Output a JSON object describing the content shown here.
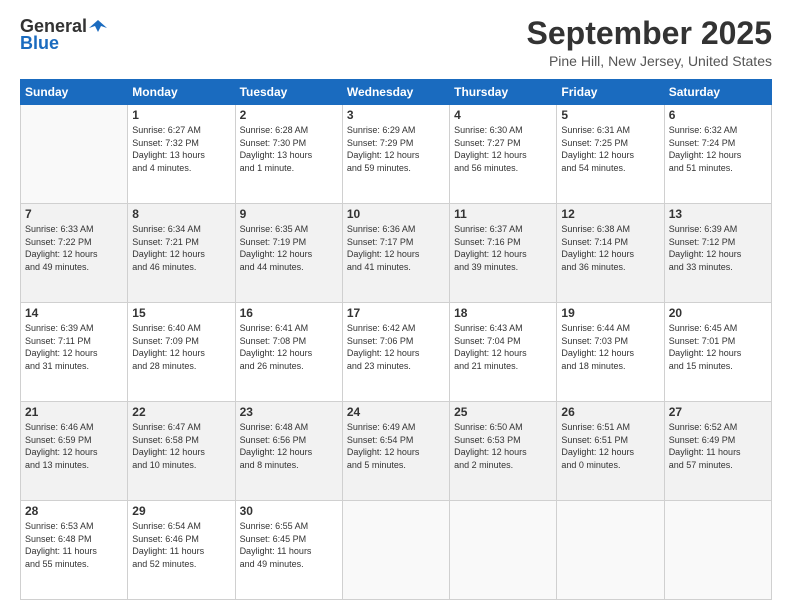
{
  "header": {
    "logo_general": "General",
    "logo_blue": "Blue",
    "month_title": "September 2025",
    "location": "Pine Hill, New Jersey, United States"
  },
  "days_of_week": [
    "Sunday",
    "Monday",
    "Tuesday",
    "Wednesday",
    "Thursday",
    "Friday",
    "Saturday"
  ],
  "weeks": [
    [
      {
        "day": "",
        "info": ""
      },
      {
        "day": "1",
        "info": "Sunrise: 6:27 AM\nSunset: 7:32 PM\nDaylight: 13 hours\nand 4 minutes."
      },
      {
        "day": "2",
        "info": "Sunrise: 6:28 AM\nSunset: 7:30 PM\nDaylight: 13 hours\nand 1 minute."
      },
      {
        "day": "3",
        "info": "Sunrise: 6:29 AM\nSunset: 7:29 PM\nDaylight: 12 hours\nand 59 minutes."
      },
      {
        "day": "4",
        "info": "Sunrise: 6:30 AM\nSunset: 7:27 PM\nDaylight: 12 hours\nand 56 minutes."
      },
      {
        "day": "5",
        "info": "Sunrise: 6:31 AM\nSunset: 7:25 PM\nDaylight: 12 hours\nand 54 minutes."
      },
      {
        "day": "6",
        "info": "Sunrise: 6:32 AM\nSunset: 7:24 PM\nDaylight: 12 hours\nand 51 minutes."
      }
    ],
    [
      {
        "day": "7",
        "info": "Sunrise: 6:33 AM\nSunset: 7:22 PM\nDaylight: 12 hours\nand 49 minutes."
      },
      {
        "day": "8",
        "info": "Sunrise: 6:34 AM\nSunset: 7:21 PM\nDaylight: 12 hours\nand 46 minutes."
      },
      {
        "day": "9",
        "info": "Sunrise: 6:35 AM\nSunset: 7:19 PM\nDaylight: 12 hours\nand 44 minutes."
      },
      {
        "day": "10",
        "info": "Sunrise: 6:36 AM\nSunset: 7:17 PM\nDaylight: 12 hours\nand 41 minutes."
      },
      {
        "day": "11",
        "info": "Sunrise: 6:37 AM\nSunset: 7:16 PM\nDaylight: 12 hours\nand 39 minutes."
      },
      {
        "day": "12",
        "info": "Sunrise: 6:38 AM\nSunset: 7:14 PM\nDaylight: 12 hours\nand 36 minutes."
      },
      {
        "day": "13",
        "info": "Sunrise: 6:39 AM\nSunset: 7:12 PM\nDaylight: 12 hours\nand 33 minutes."
      }
    ],
    [
      {
        "day": "14",
        "info": "Sunrise: 6:39 AM\nSunset: 7:11 PM\nDaylight: 12 hours\nand 31 minutes."
      },
      {
        "day": "15",
        "info": "Sunrise: 6:40 AM\nSunset: 7:09 PM\nDaylight: 12 hours\nand 28 minutes."
      },
      {
        "day": "16",
        "info": "Sunrise: 6:41 AM\nSunset: 7:08 PM\nDaylight: 12 hours\nand 26 minutes."
      },
      {
        "day": "17",
        "info": "Sunrise: 6:42 AM\nSunset: 7:06 PM\nDaylight: 12 hours\nand 23 minutes."
      },
      {
        "day": "18",
        "info": "Sunrise: 6:43 AM\nSunset: 7:04 PM\nDaylight: 12 hours\nand 21 minutes."
      },
      {
        "day": "19",
        "info": "Sunrise: 6:44 AM\nSunset: 7:03 PM\nDaylight: 12 hours\nand 18 minutes."
      },
      {
        "day": "20",
        "info": "Sunrise: 6:45 AM\nSunset: 7:01 PM\nDaylight: 12 hours\nand 15 minutes."
      }
    ],
    [
      {
        "day": "21",
        "info": "Sunrise: 6:46 AM\nSunset: 6:59 PM\nDaylight: 12 hours\nand 13 minutes."
      },
      {
        "day": "22",
        "info": "Sunrise: 6:47 AM\nSunset: 6:58 PM\nDaylight: 12 hours\nand 10 minutes."
      },
      {
        "day": "23",
        "info": "Sunrise: 6:48 AM\nSunset: 6:56 PM\nDaylight: 12 hours\nand 8 minutes."
      },
      {
        "day": "24",
        "info": "Sunrise: 6:49 AM\nSunset: 6:54 PM\nDaylight: 12 hours\nand 5 minutes."
      },
      {
        "day": "25",
        "info": "Sunrise: 6:50 AM\nSunset: 6:53 PM\nDaylight: 12 hours\nand 2 minutes."
      },
      {
        "day": "26",
        "info": "Sunrise: 6:51 AM\nSunset: 6:51 PM\nDaylight: 12 hours\nand 0 minutes."
      },
      {
        "day": "27",
        "info": "Sunrise: 6:52 AM\nSunset: 6:49 PM\nDaylight: 11 hours\nand 57 minutes."
      }
    ],
    [
      {
        "day": "28",
        "info": "Sunrise: 6:53 AM\nSunset: 6:48 PM\nDaylight: 11 hours\nand 55 minutes."
      },
      {
        "day": "29",
        "info": "Sunrise: 6:54 AM\nSunset: 6:46 PM\nDaylight: 11 hours\nand 52 minutes."
      },
      {
        "day": "30",
        "info": "Sunrise: 6:55 AM\nSunset: 6:45 PM\nDaylight: 11 hours\nand 49 minutes."
      },
      {
        "day": "",
        "info": ""
      },
      {
        "day": "",
        "info": ""
      },
      {
        "day": "",
        "info": ""
      },
      {
        "day": "",
        "info": ""
      }
    ]
  ]
}
